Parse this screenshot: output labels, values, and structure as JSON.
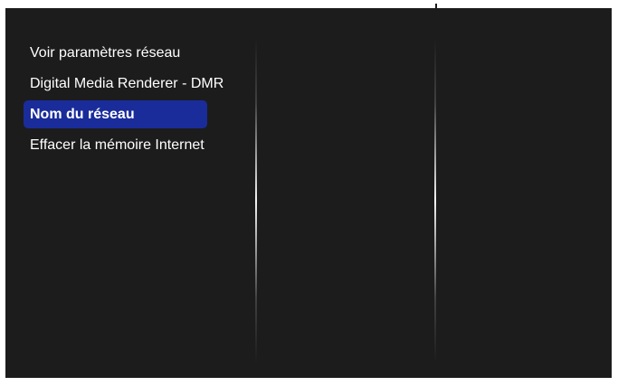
{
  "menu": {
    "items": [
      {
        "label": "Voir paramètres réseau",
        "selected": false
      },
      {
        "label": "Digital Media Renderer - DMR",
        "selected": false
      },
      {
        "label": "Nom du réseau",
        "selected": true
      },
      {
        "label": "Effacer la mémoire Internet",
        "selected": false
      }
    ]
  },
  "colors": {
    "background": "#1c1c1c",
    "highlight": "#1a2c9a",
    "text": "#ffffff"
  }
}
